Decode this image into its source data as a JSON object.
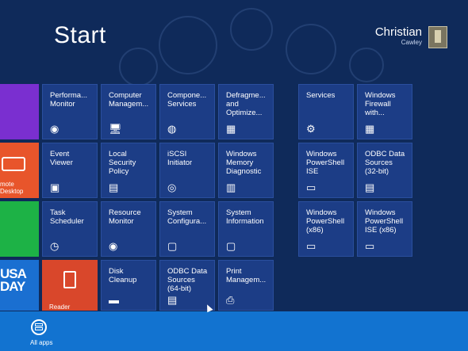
{
  "header": {
    "title": "Start",
    "user_name": "Christian",
    "user_sub": "Cawley"
  },
  "left_tiles": {
    "remote_desktop_label": "mote Desktop",
    "usa_today_text": "USA\nDAY",
    "reader_label": "Reader"
  },
  "tiles": [
    {
      "id": "performance-monitor",
      "label": "Performa...\nMonitor",
      "icon": "performance-monitor-icon",
      "glyph": "◉"
    },
    {
      "id": "computer-management",
      "label": "Computer\nManagem...",
      "icon": "computer-management-icon",
      "glyph": "🖥"
    },
    {
      "id": "component-services",
      "label": "Compone...\nServices",
      "icon": "component-services-icon",
      "glyph": "◍"
    },
    {
      "id": "defragment",
      "label": "Defragme...\nand\nOptimize...",
      "icon": "defragment-icon",
      "glyph": "▦"
    },
    {
      "id": "event-viewer",
      "label": "Event\nViewer",
      "icon": "event-viewer-icon",
      "glyph": "▣"
    },
    {
      "id": "local-security-policy",
      "label": "Local\nSecurity\nPolicy",
      "icon": "local-security-policy-icon",
      "glyph": "▤"
    },
    {
      "id": "iscsi-initiator",
      "label": "iSCSI\nInitiator",
      "icon": "iscsi-initiator-icon",
      "glyph": "◎"
    },
    {
      "id": "windows-memory-diagnostic",
      "label": "Windows\nMemory\nDiagnostic",
      "icon": "memory-diagnostic-icon",
      "glyph": "▥"
    },
    {
      "id": "task-scheduler",
      "label": "Task\nScheduler",
      "icon": "task-scheduler-icon",
      "glyph": "◷"
    },
    {
      "id": "resource-monitor",
      "label": "Resource\nMonitor",
      "icon": "resource-monitor-icon",
      "glyph": "◉"
    },
    {
      "id": "system-configuration",
      "label": "System\nConfigura...",
      "icon": "system-configuration-icon",
      "glyph": "▢"
    },
    {
      "id": "system-information",
      "label": "System\nInformation",
      "icon": "system-information-icon",
      "glyph": "▢"
    },
    {
      "id": "disk-cleanup",
      "label": "Disk\nCleanup",
      "icon": "disk-cleanup-icon",
      "glyph": "▬"
    },
    {
      "id": "odbc-64",
      "label": "ODBC Data\nSources\n(64-bit)",
      "icon": "odbc-icon",
      "glyph": "▤"
    },
    {
      "id": "print-management",
      "label": "Print\nManagem...",
      "icon": "print-management-icon",
      "glyph": "⎙"
    },
    {
      "id": "services",
      "label": "Services",
      "icon": "services-gear-icon",
      "glyph": "⚙"
    },
    {
      "id": "windows-firewall",
      "label": "Windows\nFirewall\nwith...",
      "icon": "firewall-icon",
      "glyph": "▦"
    },
    {
      "id": "powershell-ise",
      "label": "Windows\nPowerShell\nISE",
      "icon": "powershell-ise-icon",
      "glyph": "▭"
    },
    {
      "id": "odbc-32",
      "label": "ODBC Data\nSources\n(32-bit)",
      "icon": "odbc-icon",
      "glyph": "▤"
    },
    {
      "id": "powershell-x86",
      "label": "Windows\nPowerShell\n(x86)",
      "icon": "powershell-icon",
      "glyph": "▭"
    },
    {
      "id": "powershell-ise-x86",
      "label": "Windows\nPowerShell\nISE (x86)",
      "icon": "powershell-ise-icon",
      "glyph": "▭"
    }
  ],
  "taskbar": {
    "all_apps_label": "All apps"
  },
  "colors": {
    "background": "#0f2a5a",
    "tile": "#1c3d86",
    "purple": "#7a2fd0",
    "orange": "#e8552b",
    "green": "#1db246",
    "usa_today": "#1a6fd1",
    "reader": "#d9472b",
    "taskbar": "#1273d0"
  }
}
